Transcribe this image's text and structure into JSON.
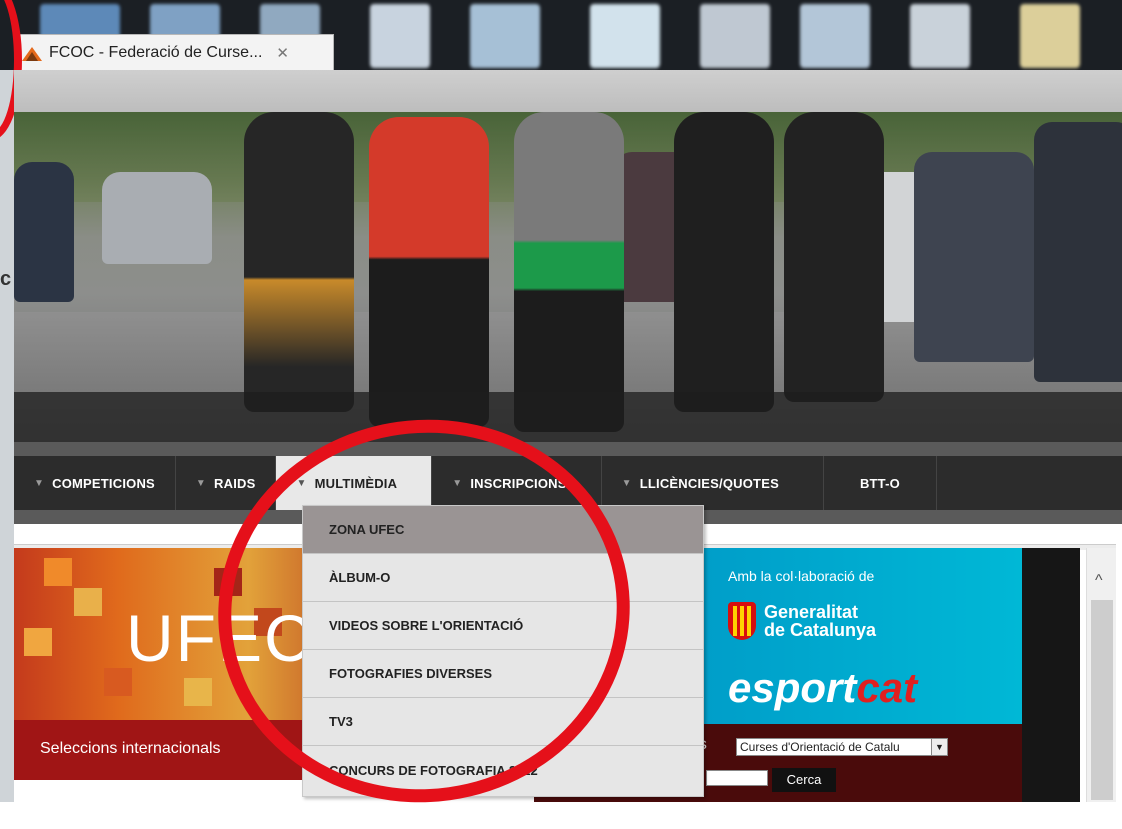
{
  "browser": {
    "tab_title": "FCOC - Federació de Curse...",
    "tab_close": "✕"
  },
  "nav": {
    "items": [
      {
        "label": "COMPETICIONS",
        "has_arrow": true
      },
      {
        "label": "RAIDS",
        "has_arrow": true
      },
      {
        "label": "MULTIMÈDIA",
        "has_arrow": true,
        "active": true
      },
      {
        "label": "INSCRIPCIONS",
        "has_arrow": true
      },
      {
        "label": "LLICÈNCIES/QUOTES",
        "has_arrow": true
      },
      {
        "label": "BTT-O",
        "has_arrow": false
      }
    ]
  },
  "dropdown": {
    "items": [
      {
        "label": "ZONA UFEC",
        "highlighted": true
      },
      {
        "label": "ÀLBUM-O"
      },
      {
        "label": "VIDEOS SOBRE L'ORIENTACIÓ"
      },
      {
        "label": "FOTOGRAFIES DIVERSES"
      },
      {
        "label": "TV3"
      },
      {
        "label": "CONCURS DE FOTOGRAFIA 2012"
      }
    ]
  },
  "content": {
    "ufec_logo": "UFEC",
    "selections_label": "Seleccions internacionals",
    "collab_label": "Amb la col·laboració de",
    "generalitat_line1": "Generalitat",
    "generalitat_line2": "de Catalunya",
    "esport_text": "esport",
    "cat_text": "cat",
    "search_prefix": "ns",
    "select_value": "Curses d'Orientació de Catalu",
    "search_button": "Cerca",
    "scroll_up": "^",
    "left_letter": "c"
  },
  "colors": {
    "annotation_red": "#e5101a",
    "nav_bg": "#2c2c2c",
    "active_tab_bg": "#e8e8e8",
    "dropdown_highlight": "#9a9494",
    "collab_blue": "#00aacf",
    "selections_red": "#a01515"
  }
}
